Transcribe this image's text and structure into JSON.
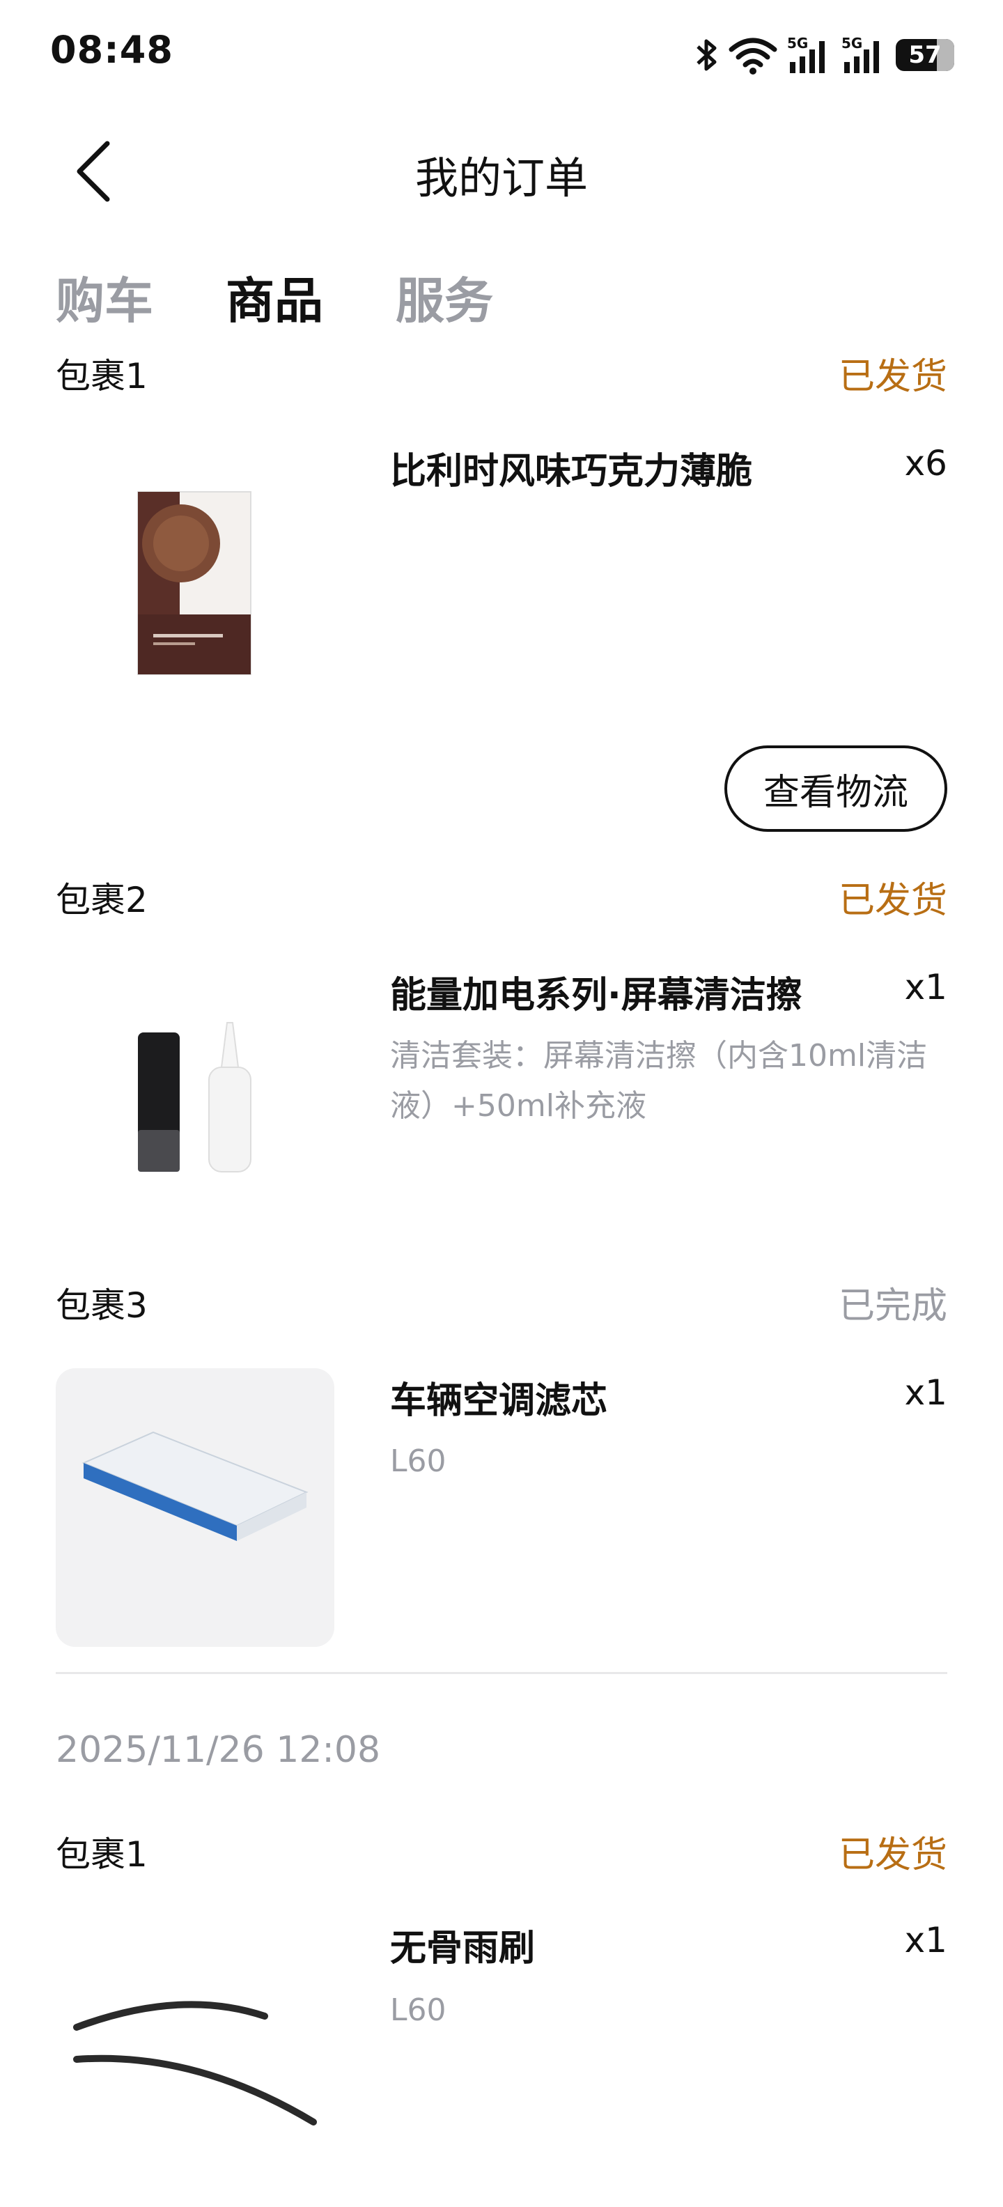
{
  "status_bar": {
    "time": "08:48",
    "battery": "57",
    "net1": "5G",
    "net2": "5G"
  },
  "header": {
    "title": "我的订单"
  },
  "tabs": [
    {
      "label": "购车",
      "active": false
    },
    {
      "label": "商品",
      "active": true
    },
    {
      "label": "服务",
      "active": false
    }
  ],
  "packages": [
    {
      "label": "包裹1",
      "status": "已发货",
      "product": "比利时风味巧克力薄脆",
      "qty": "x6",
      "action": "查看物流"
    },
    {
      "label": "包裹2",
      "status": "已发货",
      "product": "能量加电系列·屏幕清洁擦",
      "qty": "x1",
      "spec": "清洁套装：屏幕清洁擦（内含10ml清洁液）+50ml补充液"
    },
    {
      "label": "包裹3",
      "status": "已完成",
      "product": "车辆空调滤芯",
      "qty": "x1",
      "spec": "L60"
    }
  ],
  "order2": {
    "date": "2025/11/26 12:08",
    "package": {
      "label": "包裹1",
      "status": "已发货",
      "product": "无骨雨刷",
      "qty": "x1",
      "spec": "L60"
    }
  },
  "colors": {
    "shipped": "#b86e14",
    "done": "#9a9ca3",
    "text": "#111111"
  }
}
